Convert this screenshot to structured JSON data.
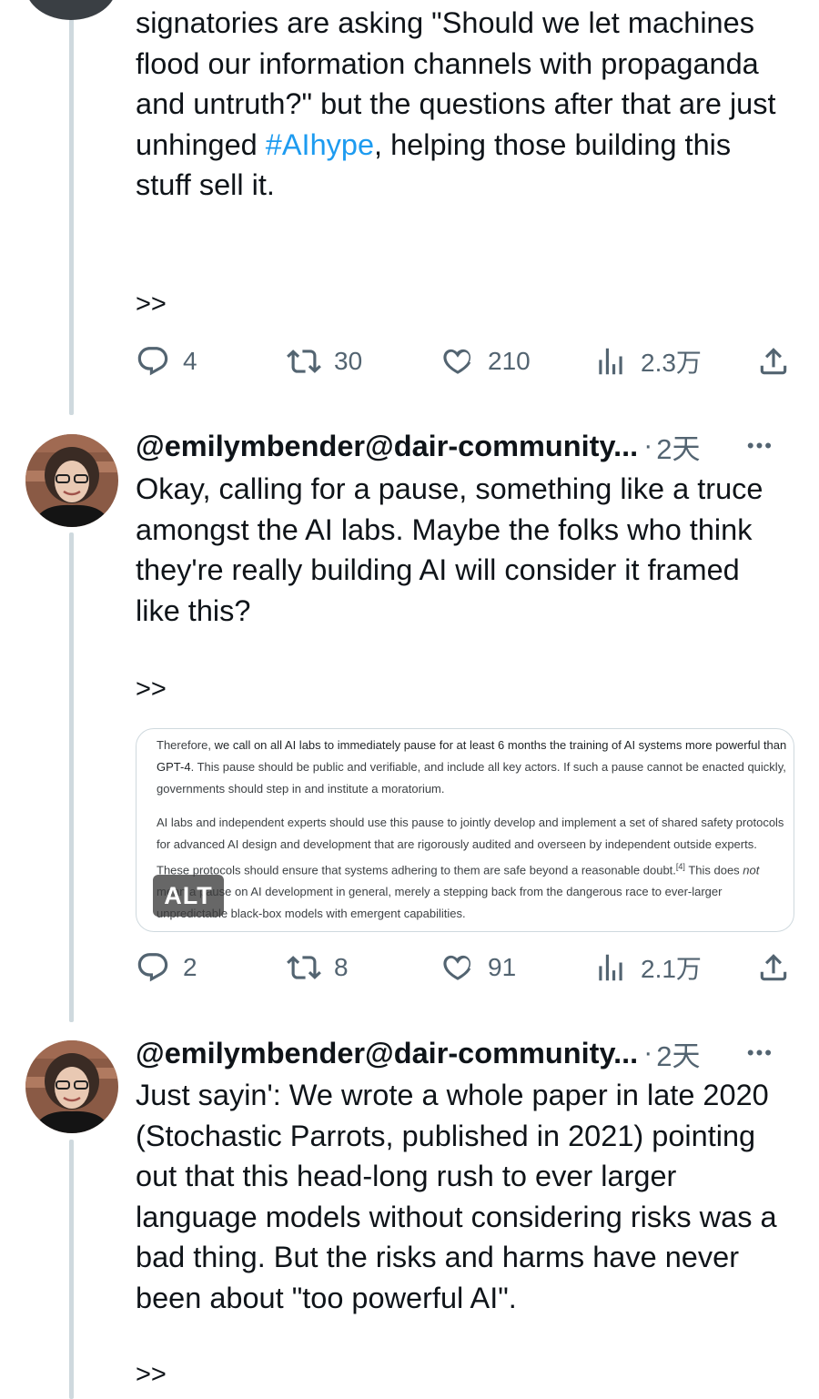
{
  "tweet0": {
    "text_before": "signatories are asking \"Should we let machines flood our information channels with propaganda and untruth?\" but the questions after that are just unhinged ",
    "hashtag": "#AIhype",
    "text_after": ", helping those building this stuff sell it.",
    "more": ">>",
    "actions": {
      "replies": "4",
      "retweets": "30",
      "likes": "210",
      "views": "2.3万"
    }
  },
  "tweet1": {
    "handle": "@emilymbender@dair-community...",
    "dot": "·",
    "time": "2天",
    "menu": "•••",
    "text": "Okay, calling for a pause, something like a truce amongst the AI labs. Maybe the folks who think they're really building AI will consider it framed like this?",
    "more": ">>",
    "media": {
      "para1_a": "Therefore, ",
      "para1_b": "we call on all AI labs to immediately pause for at least 6 months the training of AI systems more powerful than GPT-4",
      "para1_c": ". This pause should be public and verifiable, and include all key actors. If such a pause cannot be enacted quickly, governments should step in and institute a moratorium.",
      "para2_a": "AI labs and independent experts should use this pause to jointly develop and implement a set of shared safety protocols for advanced AI design and development that are rigorously audited and overseen by independent outside experts. These protocols should ensure that systems adhering to them are safe beyond a reasonable doubt.",
      "para2_ref": "[4]",
      "para2_b": " This does ",
      "para2_not": "not",
      "para2_c": " mean a pause on AI development in general, merely a stepping back from the dangerous race to ever-larger unpredictable black-box models with emergent capabilities.",
      "alt": "ALT"
    },
    "actions": {
      "replies": "2",
      "retweets": "8",
      "likes": "91",
      "views": "2.1万"
    }
  },
  "tweet2": {
    "handle": "@emilymbender@dair-community...",
    "dot": "·",
    "time": "2天",
    "menu": "•••",
    "text": "Just sayin': We wrote a whole paper in late 2020 (Stochastic Parrots, published in 2021) pointing out that this head-long rush to ever larger language models without considering risks was a bad thing. But the risks and harms have never been about \"too powerful AI\".",
    "more": ">>"
  },
  "colors": {
    "text": "#0f1419",
    "secondary": "#536471",
    "link": "#1d9bf0",
    "thread": "#cfd9de"
  },
  "icons": [
    "reply-icon",
    "retweet-icon",
    "like-icon",
    "views-icon",
    "share-icon"
  ]
}
